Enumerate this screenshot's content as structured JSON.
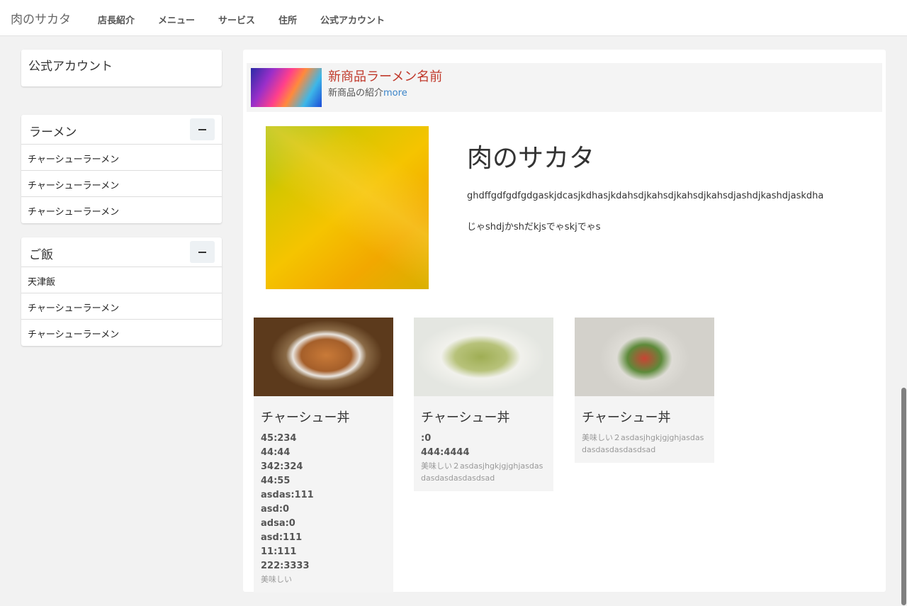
{
  "navbar": {
    "brand": "肉のサカタ",
    "links": [
      "店長紹介",
      "メニュー",
      "サービス",
      "住所",
      "公式アカウント"
    ]
  },
  "sidebar": {
    "account_title": "公式アカウント",
    "sections": [
      {
        "title": "ラーメン",
        "items": [
          "チャーシューラーメン",
          "チャーシューラーメン",
          "チャーシューラーメン"
        ]
      },
      {
        "title": "ご飯",
        "items": [
          "天津飯",
          "チャーシューラーメン",
          "チャーシューラーメン"
        ]
      }
    ]
  },
  "promo": {
    "title": "新商品ラーメン名前",
    "desc": "新商品の紹介",
    "more": "more"
  },
  "shop": {
    "name": "肉のサカタ",
    "desc1": "ghdffgdfgdfgdgaskjdcasjkdhasjkdahsdjkahsdjkahsdjkahsdjashdjkashdjaskdha",
    "desc2": "じゃshdjかshだkjsでゃskjでゃs"
  },
  "cards": [
    {
      "title": "チャーシュー丼",
      "rows": [
        "45:234",
        "44:44",
        "342:324",
        "44:55",
        "asdas:111",
        "asd:0",
        "adsa:0",
        "asd:111",
        "11:111",
        "222:3333"
      ],
      "note": "美味しい"
    },
    {
      "title": "チャーシュー丼",
      "rows": [
        ":0",
        "444:4444"
      ],
      "note": "美味しい２asdasjhgkjgjghjasdasdasdasdasdasdsad"
    },
    {
      "title": "チャーシュー丼",
      "rows": [],
      "note": "美味しい２asdasjhgkjgjghjasdasdasdasdasdasdsad"
    }
  ]
}
